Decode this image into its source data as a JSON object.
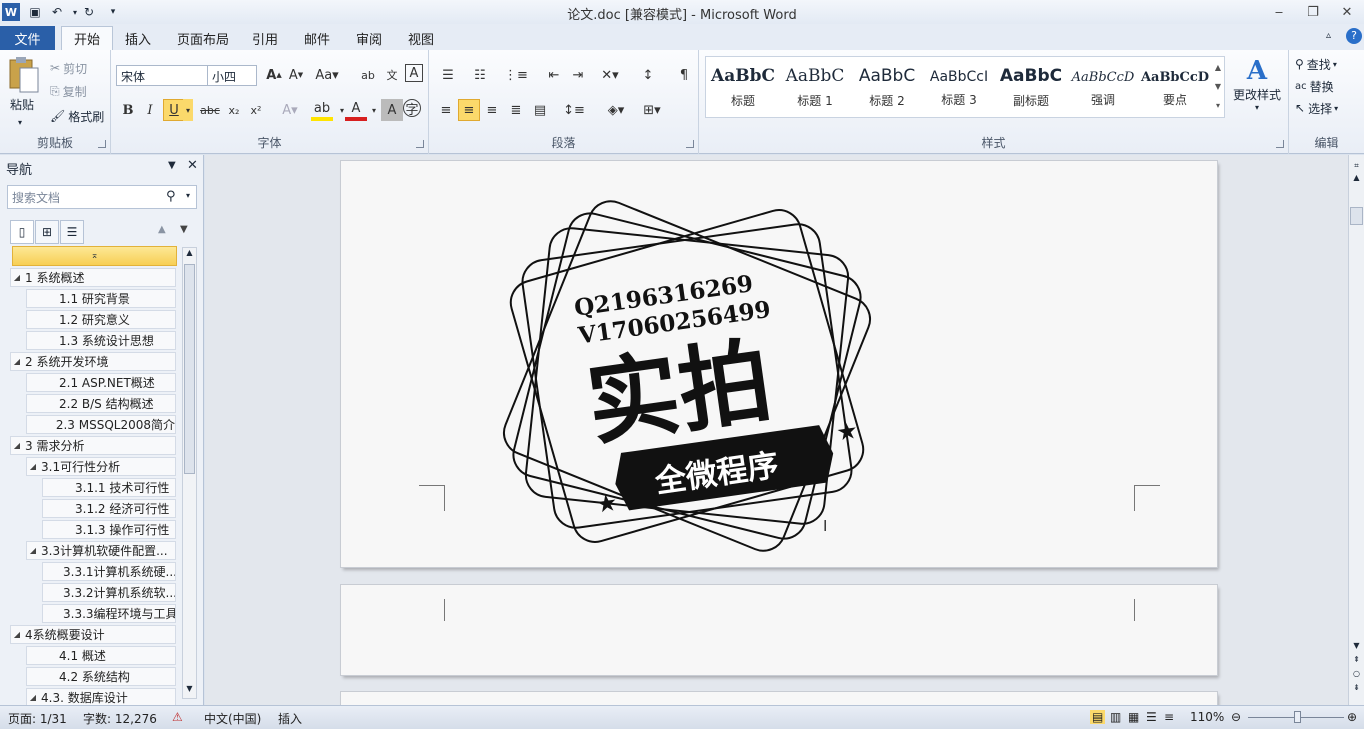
{
  "window": {
    "title": "论文.doc [兼容模式] - Microsoft Word"
  },
  "tabs": {
    "file": "文件",
    "home": "开始",
    "insert": "插入",
    "layout": "页面布局",
    "references": "引用",
    "mailings": "邮件",
    "review": "审阅",
    "view": "视图"
  },
  "clipboard": {
    "paste": "粘贴",
    "cut": "剪切",
    "copy": "复制",
    "format_painter": "格式刷",
    "label": "剪贴板"
  },
  "font": {
    "name": "宋体",
    "size": "小四",
    "label": "字体"
  },
  "paragraph": {
    "label": "段落"
  },
  "styles": {
    "label": "样式",
    "items": [
      {
        "sample": "AaBbC",
        "name": "标题"
      },
      {
        "sample": "AaBbC",
        "name": "标题 1"
      },
      {
        "sample": "AaBbC",
        "name": "标题 2"
      },
      {
        "sample": "AaBbCcI",
        "name": "标题 3"
      },
      {
        "sample": "AaBbC",
        "name": "副标题"
      },
      {
        "sample": "AaBbCcD",
        "name": "强调"
      },
      {
        "sample": "AaBbCcD",
        "name": "要点"
      }
    ],
    "change": "更改样式"
  },
  "editing": {
    "find": "查找",
    "replace": "替换",
    "select": "选择",
    "label": "编辑"
  },
  "nav": {
    "title": "导航",
    "search_placeholder": "搜索文档",
    "outline": [
      {
        "text": "1 系统概述",
        "level": 1
      },
      {
        "text": "1.1 研究背景",
        "level": 2
      },
      {
        "text": "1.2 研究意义",
        "level": 2
      },
      {
        "text": "1.3 系统设计思想",
        "level": 2
      },
      {
        "text": "2 系统开发环境",
        "level": 1
      },
      {
        "text": "2.1 ASP.NET概述",
        "level": 2
      },
      {
        "text": "2.2 B/S 结构概述",
        "level": 2
      },
      {
        "text": "2.3 MSSQL2008简介",
        "level": 2
      },
      {
        "text": "3 需求分析",
        "level": 1
      },
      {
        "text": "3.1可行性分析",
        "level": 2,
        "expandable": true
      },
      {
        "text": "3.1.1 技术可行性",
        "level": 3
      },
      {
        "text": "3.1.2 经济可行性",
        "level": 3
      },
      {
        "text": "3.1.3 操作可行性",
        "level": 3
      },
      {
        "text": "3.3计算机软硬件配置...",
        "level": 2,
        "expandable": true
      },
      {
        "text": "3.3.1计算机系统硬...",
        "level": 3
      },
      {
        "text": "3.3.2计算机系统软...",
        "level": 3
      },
      {
        "text": "3.3.3编程环境与工具",
        "level": 3
      },
      {
        "text": "4系统概要设计",
        "level": 1
      },
      {
        "text": "4.1 概述",
        "level": 2
      },
      {
        "text": "4.2 系统结构",
        "level": 2
      },
      {
        "text": "4.3. 数据库设计",
        "level": 2,
        "expandable": true
      }
    ]
  },
  "watermark": {
    "line1": "Q2196316269",
    "line2": "V17060256499",
    "big": "实拍",
    "banner": "全微程序"
  },
  "status": {
    "page": "页面: 1/31",
    "words": "字数: 12,276",
    "lang": "中文(中国)",
    "mode": "插入",
    "zoom": "110%"
  }
}
